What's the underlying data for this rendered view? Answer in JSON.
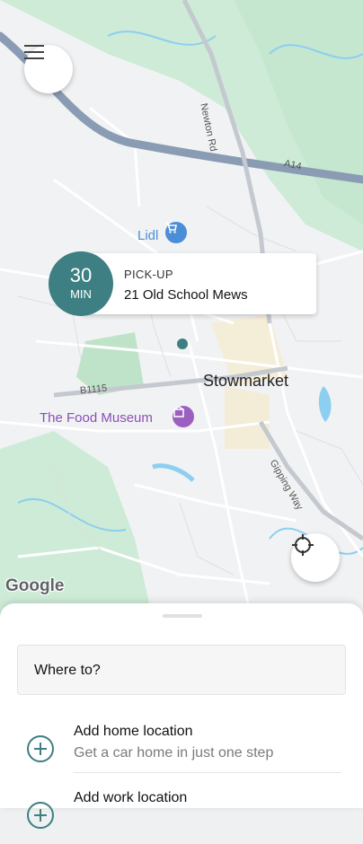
{
  "map": {
    "labels": {
      "town": "Stowmarket",
      "lidl": "Lidl",
      "museum": "The Food Museum",
      "road_b1115": "B1115",
      "road_a14": "A14",
      "road_newton": "Newton Rd",
      "road_gipping": "Gipping Way"
    },
    "attribution": "Google",
    "colors": {
      "accent": "#3d7f82",
      "park": "#cdebd6",
      "water": "#8ccff0",
      "motorway": "#8a9bb4"
    }
  },
  "menu": {
    "icon": "hamburger-menu-icon"
  },
  "pickup": {
    "eta_value": "30",
    "eta_unit": "MIN",
    "label": "PICK-UP",
    "address": "21 Old School Mews",
    "chevron_icon": "chevron-right-icon"
  },
  "locate": {
    "icon": "crosshair-icon"
  },
  "sheet": {
    "search_placeholder": "Where to?",
    "saved_locations": [
      {
        "title": "Add home location",
        "subtitle": "Get a car home in just one step",
        "icon": "plus-circle-icon"
      },
      {
        "title": "Add work location",
        "subtitle": "",
        "icon": "plus-circle-icon"
      }
    ]
  }
}
